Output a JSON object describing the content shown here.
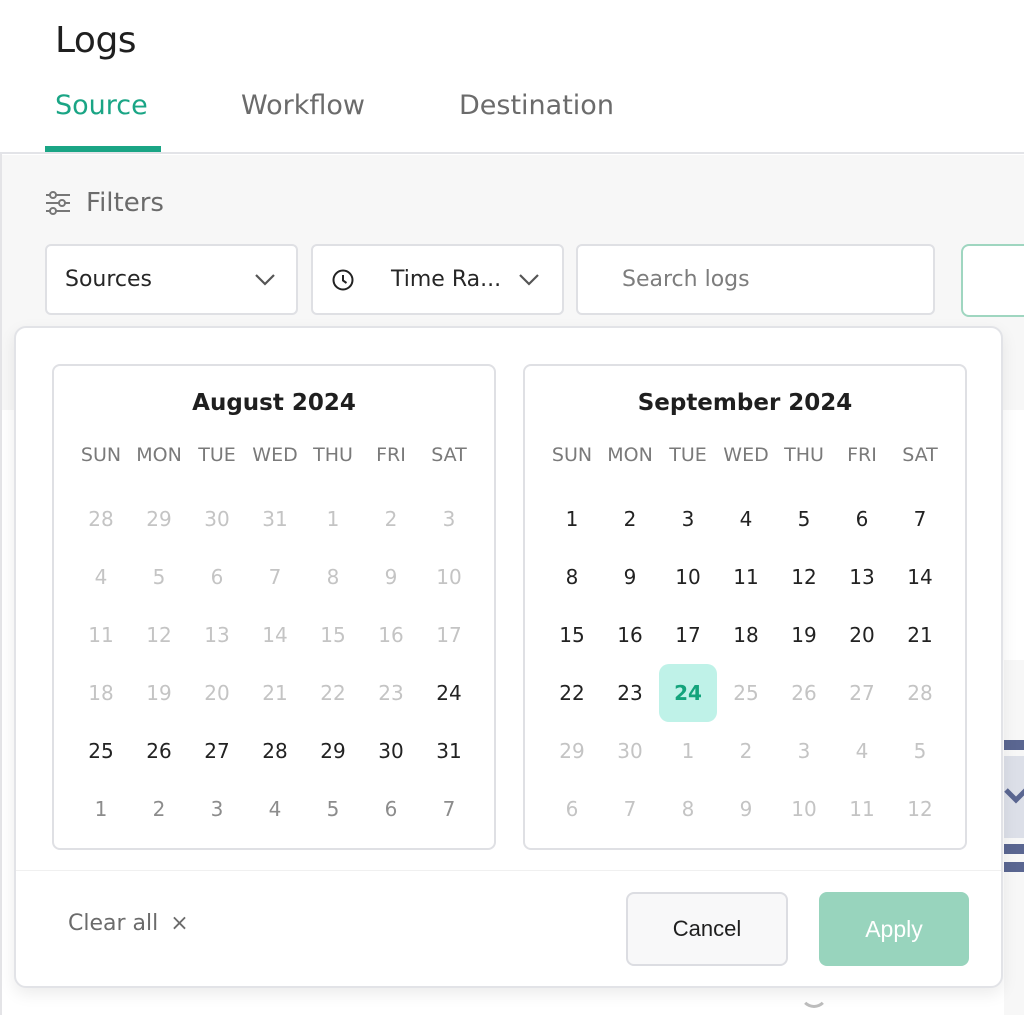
{
  "page": {
    "title": "Logs"
  },
  "tabs": [
    {
      "label": "Source",
      "active": true
    },
    {
      "label": "Workflow",
      "active": false
    },
    {
      "label": "Destination",
      "active": false
    }
  ],
  "colors": {
    "accent": "#1aa585",
    "selected_bg": "#bff2e8",
    "apply_bg": "#98d4bd"
  },
  "filters": {
    "label": "Filters",
    "icon": "sliders-icon",
    "sources": {
      "value": "Sources",
      "icon": "chevron-down-icon"
    },
    "time_range": {
      "value": "Time Ra...",
      "icon": "clock-icon",
      "chevron": "chevron-down-icon"
    },
    "search": {
      "value": "",
      "placeholder": "Search logs"
    }
  },
  "date_picker": {
    "weekdays": [
      "SUN",
      "MON",
      "TUE",
      "WED",
      "THU",
      "FRI",
      "SAT"
    ],
    "months": [
      {
        "title": "August 2024",
        "weeks": [
          [
            {
              "d": "28",
              "s": "disabled"
            },
            {
              "d": "29",
              "s": "disabled"
            },
            {
              "d": "30",
              "s": "disabled"
            },
            {
              "d": "31",
              "s": "disabled"
            },
            {
              "d": "1",
              "s": "disabled"
            },
            {
              "d": "2",
              "s": "disabled"
            },
            {
              "d": "3",
              "s": "disabled"
            }
          ],
          [
            {
              "d": "4",
              "s": "disabled"
            },
            {
              "d": "5",
              "s": "disabled"
            },
            {
              "d": "6",
              "s": "disabled"
            },
            {
              "d": "7",
              "s": "disabled"
            },
            {
              "d": "8",
              "s": "disabled"
            },
            {
              "d": "9",
              "s": "disabled"
            },
            {
              "d": "10",
              "s": "disabled"
            }
          ],
          [
            {
              "d": "11",
              "s": "disabled"
            },
            {
              "d": "12",
              "s": "disabled"
            },
            {
              "d": "13",
              "s": "disabled"
            },
            {
              "d": "14",
              "s": "disabled"
            },
            {
              "d": "15",
              "s": "disabled"
            },
            {
              "d": "16",
              "s": "disabled"
            },
            {
              "d": "17",
              "s": "disabled"
            }
          ],
          [
            {
              "d": "18",
              "s": "disabled"
            },
            {
              "d": "19",
              "s": "disabled"
            },
            {
              "d": "20",
              "s": "disabled"
            },
            {
              "d": "21",
              "s": "disabled"
            },
            {
              "d": "22",
              "s": "disabled"
            },
            {
              "d": "23",
              "s": "disabled"
            },
            {
              "d": "24",
              "s": "enabled"
            }
          ],
          [
            {
              "d": "25",
              "s": "enabled"
            },
            {
              "d": "26",
              "s": "enabled"
            },
            {
              "d": "27",
              "s": "enabled"
            },
            {
              "d": "28",
              "s": "enabled"
            },
            {
              "d": "29",
              "s": "enabled"
            },
            {
              "d": "30",
              "s": "enabled"
            },
            {
              "d": "31",
              "s": "enabled"
            }
          ],
          [
            {
              "d": "1",
              "s": "outside"
            },
            {
              "d": "2",
              "s": "outside"
            },
            {
              "d": "3",
              "s": "outside"
            },
            {
              "d": "4",
              "s": "outside"
            },
            {
              "d": "5",
              "s": "outside"
            },
            {
              "d": "6",
              "s": "outside"
            },
            {
              "d": "7",
              "s": "outside"
            }
          ]
        ]
      },
      {
        "title": "September 2024",
        "weeks": [
          [
            {
              "d": "1",
              "s": "enabled"
            },
            {
              "d": "2",
              "s": "enabled"
            },
            {
              "d": "3",
              "s": "enabled"
            },
            {
              "d": "4",
              "s": "enabled"
            },
            {
              "d": "5",
              "s": "enabled"
            },
            {
              "d": "6",
              "s": "enabled"
            },
            {
              "d": "7",
              "s": "enabled"
            }
          ],
          [
            {
              "d": "8",
              "s": "enabled"
            },
            {
              "d": "9",
              "s": "enabled"
            },
            {
              "d": "10",
              "s": "enabled"
            },
            {
              "d": "11",
              "s": "enabled"
            },
            {
              "d": "12",
              "s": "enabled"
            },
            {
              "d": "13",
              "s": "enabled"
            },
            {
              "d": "14",
              "s": "enabled"
            }
          ],
          [
            {
              "d": "15",
              "s": "enabled"
            },
            {
              "d": "16",
              "s": "enabled"
            },
            {
              "d": "17",
              "s": "enabled"
            },
            {
              "d": "18",
              "s": "enabled"
            },
            {
              "d": "19",
              "s": "enabled"
            },
            {
              "d": "20",
              "s": "enabled"
            },
            {
              "d": "21",
              "s": "enabled"
            }
          ],
          [
            {
              "d": "22",
              "s": "enabled"
            },
            {
              "d": "23",
              "s": "enabled"
            },
            {
              "d": "24",
              "s": "selected"
            },
            {
              "d": "25",
              "s": "disabled"
            },
            {
              "d": "26",
              "s": "disabled"
            },
            {
              "d": "27",
              "s": "disabled"
            },
            {
              "d": "28",
              "s": "disabled"
            }
          ],
          [
            {
              "d": "29",
              "s": "disabled"
            },
            {
              "d": "30",
              "s": "disabled"
            },
            {
              "d": "1",
              "s": "disabled"
            },
            {
              "d": "2",
              "s": "disabled"
            },
            {
              "d": "3",
              "s": "disabled"
            },
            {
              "d": "4",
              "s": "disabled"
            },
            {
              "d": "5",
              "s": "disabled"
            }
          ],
          [
            {
              "d": "6",
              "s": "disabled"
            },
            {
              "d": "7",
              "s": "disabled"
            },
            {
              "d": "8",
              "s": "disabled"
            },
            {
              "d": "9",
              "s": "disabled"
            },
            {
              "d": "10",
              "s": "disabled"
            },
            {
              "d": "11",
              "s": "disabled"
            },
            {
              "d": "12",
              "s": "disabled"
            }
          ]
        ]
      }
    ],
    "footer": {
      "clear_all_label": "Clear all",
      "clear_all_icon": "×",
      "cancel_label": "Cancel",
      "apply_label": "Apply"
    }
  }
}
